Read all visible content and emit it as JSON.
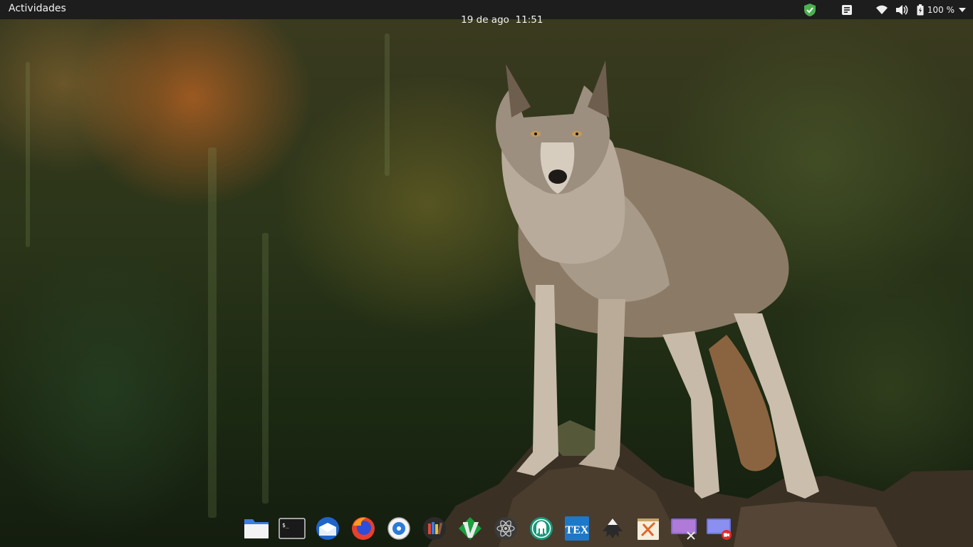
{
  "topbar": {
    "activities_label": "Actividades",
    "date": "19 de ago",
    "time": "11:51",
    "battery_percent": "100 %",
    "tray_icons": [
      "shield-check-icon",
      "notes-icon",
      "wifi-icon",
      "volume-icon",
      "battery-icon",
      "chevron-down-icon"
    ]
  },
  "dock": {
    "items": [
      {
        "name": "files",
        "icon": "folder-icon"
      },
      {
        "name": "terminal",
        "icon": "terminal-icon",
        "label": "$_"
      },
      {
        "name": "thunderbird",
        "icon": "thunderbird-icon"
      },
      {
        "name": "firefox",
        "icon": "firefox-icon"
      },
      {
        "name": "web-browser",
        "icon": "compass-icon"
      },
      {
        "name": "bookshelf",
        "icon": "books-icon"
      },
      {
        "name": "vim",
        "icon": "vim-icon"
      },
      {
        "name": "atom",
        "icon": "atom-icon"
      },
      {
        "name": "gitkraken",
        "icon": "gitkraken-icon"
      },
      {
        "name": "texmaker",
        "icon": "tex-icon",
        "label": "TEX"
      },
      {
        "name": "inkscape",
        "icon": "inkscape-icon"
      },
      {
        "name": "text-editor",
        "icon": "notepad-icon"
      },
      {
        "name": "screenshot",
        "icon": "screenshot-icon"
      },
      {
        "name": "screen-recorder",
        "icon": "screen-recorder-icon"
      }
    ]
  },
  "colors": {
    "topbar_bg": "#1d1d1d",
    "shield_green": "#4caf50",
    "firefox_blue": "#2f4dd6",
    "vim_green": "#1b9e3e",
    "tex_blue": "#1e78c8"
  }
}
